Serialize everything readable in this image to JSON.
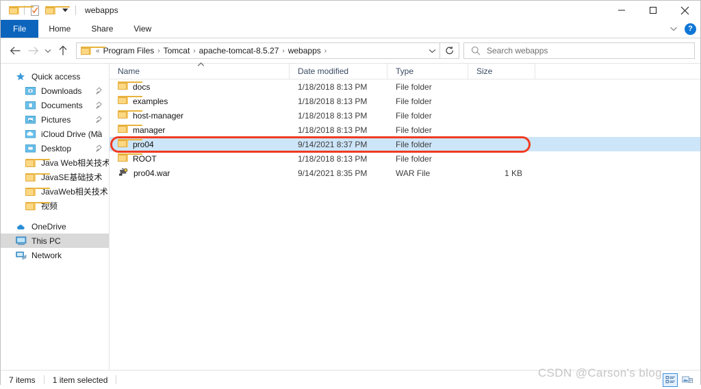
{
  "window": {
    "title": "webapps",
    "quick_access": [
      {
        "name": "folder-icon",
        "label": "Folder"
      },
      {
        "name": "properties-icon",
        "label": "Properties"
      },
      {
        "name": "new-folder-icon",
        "label": "New folder"
      },
      {
        "name": "chevron-down-icon",
        "label": "Customize Quick Access Toolbar"
      }
    ],
    "controls": [
      {
        "name": "minimize-button",
        "label": "Minimize"
      },
      {
        "name": "maximize-button",
        "label": "Maximize"
      },
      {
        "name": "close-button",
        "label": "Close"
      }
    ]
  },
  "ribbon": {
    "tabs": [
      {
        "label": "File"
      },
      {
        "label": "Home"
      },
      {
        "label": "Share"
      },
      {
        "label": "View"
      }
    ],
    "collapse_label": "⌄",
    "help_label": "?"
  },
  "nav": {
    "back_label": "←",
    "forward_label": "→",
    "recent_label": "⌄",
    "up_label": "↑",
    "overflow_label": "«",
    "breadcrumbs": [
      "Program Files",
      "Tomcat",
      "apache-tomcat-8.5.27",
      "webapps"
    ],
    "separator": "›",
    "dropdown_label": "⌄",
    "refresh_label": "↻"
  },
  "search": {
    "placeholder": "Search webapps",
    "value": ""
  },
  "sidebar": {
    "items": [
      {
        "label": "Quick access",
        "icon": "star-icon",
        "level": 1,
        "pinned": false,
        "selected": false
      },
      {
        "label": "Downloads",
        "icon": "downloads-folder-icon",
        "level": 2,
        "pinned": true,
        "selected": false
      },
      {
        "label": "Documents",
        "icon": "documents-folder-icon",
        "level": 2,
        "pinned": true,
        "selected": false
      },
      {
        "label": "Pictures",
        "icon": "pictures-folder-icon",
        "level": 2,
        "pinned": true,
        "selected": false
      },
      {
        "label": "iCloud Drive (Ma",
        "icon": "icloud-folder-icon",
        "level": 2,
        "pinned": true,
        "selected": false
      },
      {
        "label": "Desktop",
        "icon": "desktop-folder-icon",
        "level": 2,
        "pinned": true,
        "selected": false
      },
      {
        "label": "Java Web相关技术",
        "icon": "folder-icon",
        "level": 2,
        "pinned": false,
        "selected": false
      },
      {
        "label": "JavaSE基础技术",
        "icon": "folder-icon",
        "level": 2,
        "pinned": false,
        "selected": false
      },
      {
        "label": "JavaWeb相关技术",
        "icon": "folder-icon",
        "level": 2,
        "pinned": false,
        "selected": false
      },
      {
        "label": "视频",
        "icon": "folder-icon",
        "level": 2,
        "pinned": false,
        "selected": false
      },
      {
        "label": "OneDrive",
        "icon": "cloud-icon",
        "level": 1,
        "pinned": false,
        "selected": false
      },
      {
        "label": "This PC",
        "icon": "monitor-icon",
        "level": 1,
        "pinned": false,
        "selected": true
      },
      {
        "label": "Network",
        "icon": "network-icon",
        "level": 1,
        "pinned": false,
        "selected": false
      }
    ]
  },
  "file_list": {
    "columns": [
      {
        "label": "Name",
        "sorted": "asc"
      },
      {
        "label": "Date modified",
        "sorted": ""
      },
      {
        "label": "Type",
        "sorted": ""
      },
      {
        "label": "Size",
        "sorted": ""
      }
    ],
    "sort_caret": "▲",
    "rows": [
      {
        "name": "docs",
        "date": "1/18/2018 8:13 PM",
        "type": "File folder",
        "size": "",
        "icon": "folder-icon",
        "selected": false
      },
      {
        "name": "examples",
        "date": "1/18/2018 8:13 PM",
        "type": "File folder",
        "size": "",
        "icon": "folder-icon",
        "selected": false
      },
      {
        "name": "host-manager",
        "date": "1/18/2018 8:13 PM",
        "type": "File folder",
        "size": "",
        "icon": "folder-icon",
        "selected": false
      },
      {
        "name": "manager",
        "date": "1/18/2018 8:13 PM",
        "type": "File folder",
        "size": "",
        "icon": "folder-icon",
        "selected": false
      },
      {
        "name": "pro04",
        "date": "9/14/2021 8:37 PM",
        "type": "File folder",
        "size": "",
        "icon": "folder-icon",
        "selected": true
      },
      {
        "name": "ROOT",
        "date": "1/18/2018 8:13 PM",
        "type": "File folder",
        "size": "",
        "icon": "folder-icon",
        "selected": false
      },
      {
        "name": "pro04.war",
        "date": "9/14/2021 8:35 PM",
        "type": "WAR File",
        "size": "1 KB",
        "icon": "archive-icon",
        "selected": false
      }
    ],
    "annotation": {
      "target_row": "pro04",
      "color": "#f03b20"
    }
  },
  "status": {
    "item_count": "7 items",
    "selection": "1 item selected",
    "views": [
      {
        "name": "details-view-button",
        "label": "Details view",
        "active": true
      },
      {
        "name": "large-icons-view-button",
        "label": "Large icons view",
        "active": false
      }
    ]
  },
  "watermark": {
    "text": "CSDN @Carson's blog"
  },
  "colors": {
    "accent": "#0c64bd",
    "selection": "#cde5f8",
    "sidebar_selection": "#d9d9d9",
    "annotation": "#f03b20",
    "folder": "#fcd884"
  }
}
